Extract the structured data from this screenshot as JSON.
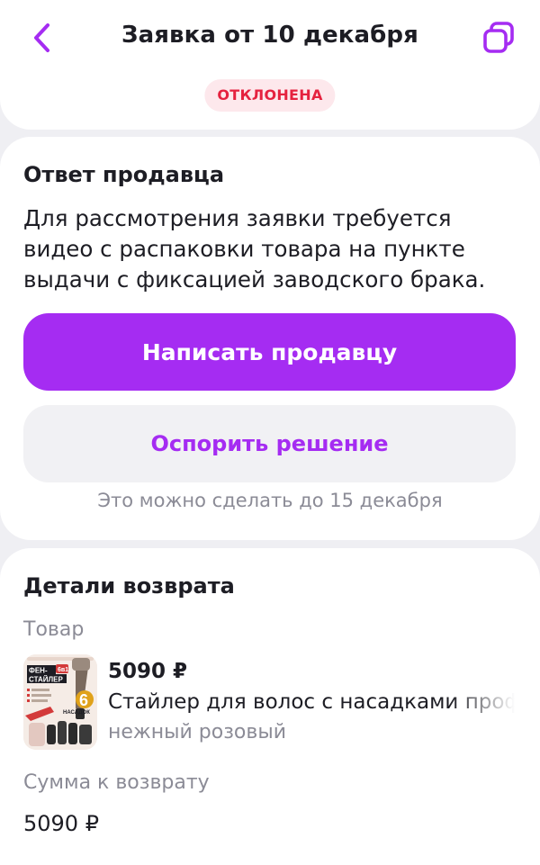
{
  "header": {
    "title": "Заявка от 10 декабря",
    "status": "ОТКЛОНЕНА",
    "back_icon": "chevron-left-icon",
    "copy_icon": "copy-icon"
  },
  "seller_answer": {
    "title": "Ответ продавца",
    "text": "Для рассмотрения заявки требуется видео с распаковки товара на пункте выдачи с фиксацией заводского брака.",
    "write_button": "Написать продавцу",
    "dispute_button": "Оспорить решение",
    "deadline_note": "Это можно сделать до 15 декабря"
  },
  "return_details": {
    "title": "Детали возврата",
    "product_label": "Товар",
    "product": {
      "price": "5090 ₽",
      "name": "Стайлер для волос с насадками профе",
      "variant": "нежный розовый",
      "thumb_text_1": "ФЕН-",
      "thumb_text_2": "СТАЙЛЕР",
      "thumb_badge": "6в1",
      "thumb_count": "6",
      "thumb_count_label": "НАСАДОК"
    },
    "refund_label": "Сумма к возврату",
    "refund_amount": "5090 ₽"
  },
  "colors": {
    "accent": "#a52cf2",
    "status_bg": "#fde8ec",
    "status_text": "#e5223f",
    "background": "#efeff3"
  }
}
